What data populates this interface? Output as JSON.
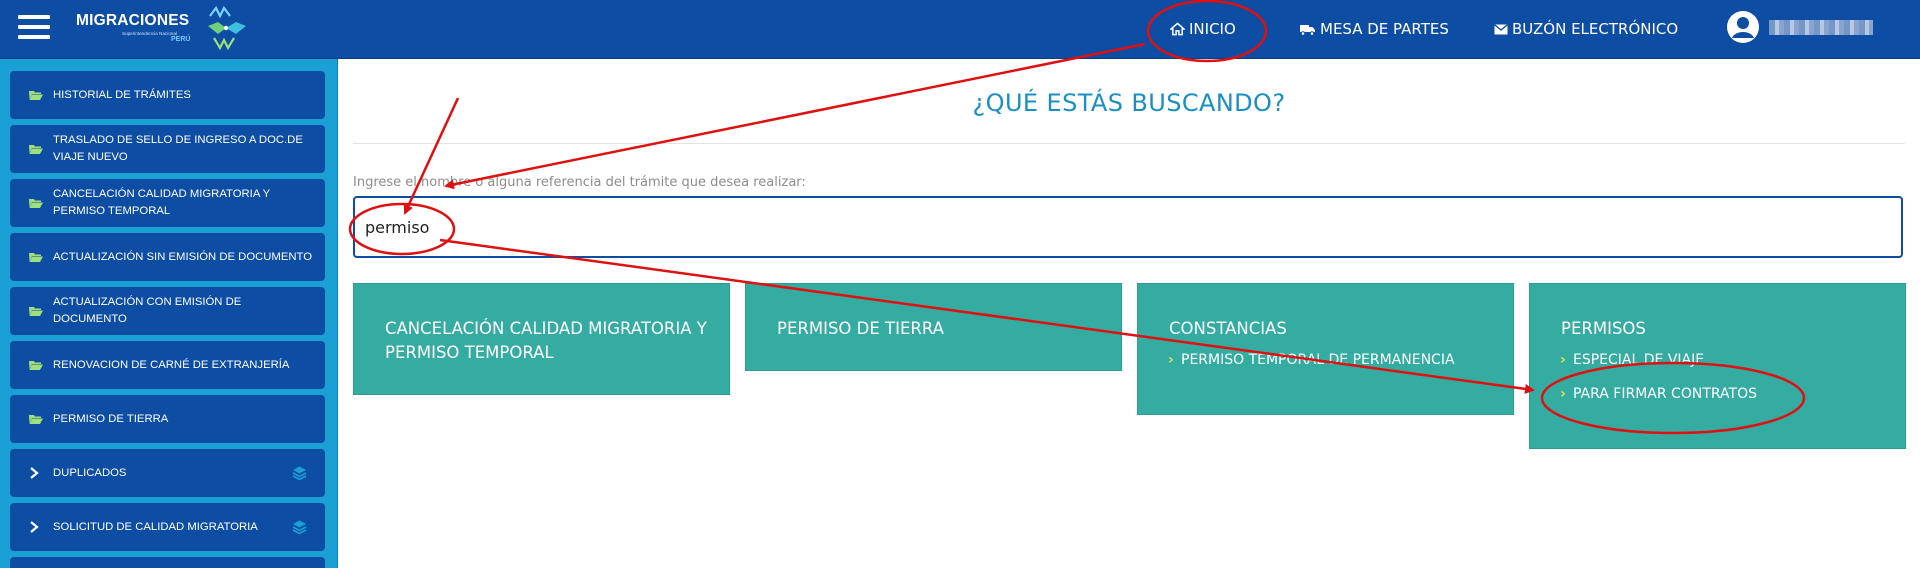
{
  "header": {
    "logo_title": "MIGRACIONES",
    "logo_subtitle": "Superintendencia Nacional",
    "logo_country": "PERÚ",
    "nav": {
      "inicio": "INICIO",
      "mesa": "MESA DE PARTES",
      "buzon": "BUZÓN ELECTRÓNICO"
    }
  },
  "sidebar": {
    "items": [
      {
        "label": "HISTORIAL DE TRÁMITES",
        "icon": "folder-open-icon"
      },
      {
        "label": "TRASLADO DE SELLO DE INGRESO A DOC.DE VIAJE NUEVO",
        "icon": "folder-open-icon"
      },
      {
        "label": "CANCELACIÓN CALIDAD MIGRATORIA Y PERMISO TEMPORAL",
        "icon": "folder-open-icon"
      },
      {
        "label": "ACTUALIZACIÓN SIN EMISIÓN DE DOCUMENTO",
        "icon": "folder-open-icon"
      },
      {
        "label": "ACTUALIZACIÓN CON EMISIÓN DE DOCUMENTO",
        "icon": "folder-open-icon"
      },
      {
        "label": "RENOVACION DE CARNÉ DE EXTRANJERÍA",
        "icon": "folder-open-icon"
      },
      {
        "label": "PERMISO DE TIERRA",
        "icon": "folder-open-icon"
      },
      {
        "label": "DUPLICADOS",
        "icon": "chevron-right-icon"
      },
      {
        "label": "SOLICITUD DE CALIDAD MIGRATORIA",
        "icon": "chevron-right-icon"
      }
    ]
  },
  "main": {
    "heading": "¿QUÉ ESTÁS BUSCANDO?",
    "help_text": "Ingrese el nombre o alguna referencia del trámite que desea realizar:",
    "search_value": "permiso",
    "cards": [
      {
        "title": "CANCELACIÓN CALIDAD MIGRATORIA Y PERMISO TEMPORAL",
        "links": []
      },
      {
        "title": "PERMISO DE TIERRA",
        "links": []
      },
      {
        "title": "CONSTANCIAS",
        "links": [
          "PERMISO TEMPORAL DE PERMANENCIA"
        ]
      },
      {
        "title": "PERMISOS",
        "links": [
          "ESPECIAL DE VIAJE",
          "PARA FIRMAR CONTRATOS"
        ]
      }
    ]
  },
  "colors": {
    "header": "#0d4da3",
    "sidebar": "#1aa0d4",
    "card": "#35aca1",
    "heading": "#1a8fc3",
    "annotation": "#e01010"
  }
}
